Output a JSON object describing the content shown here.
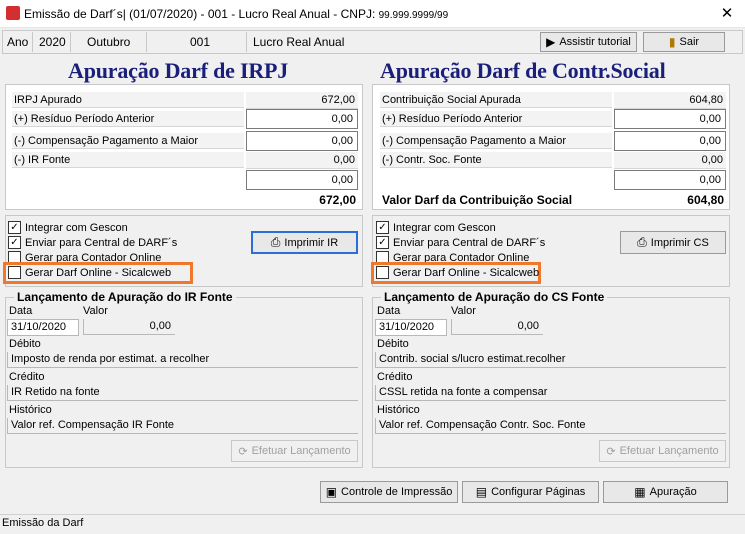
{
  "window": {
    "title": "Emissão de Darf´s| (01/07/2020) - 001 - Lucro Real Anual  - CNPJ:",
    "cnpj": "99.999.9999/99",
    "close": "✕"
  },
  "toolbar": {
    "ano_label": "Ano",
    "ano_value": "2020",
    "mes": "Outubro",
    "empresa": "001",
    "regime": "Lucro Real Anual",
    "tutorial_label": "Assistir tutorial",
    "sair_label": "Sair"
  },
  "irpj": {
    "heading": "Apuração Darf de IRPJ",
    "rows": [
      {
        "label": "IRPJ Apurado",
        "value": "672,00"
      },
      {
        "label": "(+) Resíduo Período Anterior",
        "value": "0,00"
      },
      {
        "label": "(-) Compensação Pagamento a Maior",
        "value": "0,00"
      },
      {
        "label": "(-) IR Fonte",
        "value": "0,00"
      }
    ],
    "extra_value": "0,00",
    "total_label": "",
    "total_value": "672,00",
    "checks": [
      {
        "label": "Integrar com Gescon",
        "checked": true
      },
      {
        "label": "Enviar para Central de DARF´s",
        "checked": true
      },
      {
        "label": "Gerar para Contador Online",
        "checked": false
      },
      {
        "label": "Gerar Darf Online - Sicalcweb",
        "checked": false
      }
    ],
    "print_label": "Imprimir IR",
    "launch": {
      "title": "Lançamento de Apuração do IR Fonte",
      "data_label": "Data",
      "valor_label": "Valor",
      "data": "31/10/2020",
      "valor": "0,00",
      "debito_label": "Débito",
      "debito": "Imposto de renda por estimat. a recolher",
      "credito_label": "Crédito",
      "credito": "IR Retido na fonte",
      "historico_label": "Histórico",
      "historico": "Valor ref. Compensação IR Fonte",
      "button": "Efetuar Lançamento"
    }
  },
  "cs": {
    "heading": "Apuração Darf de Contr.Social",
    "rows": [
      {
        "label": "Contribuição Social Apurada",
        "value": "604,80"
      },
      {
        "label": "(+) Resíduo Período Anterior",
        "value": "0,00"
      },
      {
        "label": "(-) Compensação Pagamento a Maior",
        "value": "0,00"
      },
      {
        "label": "(-) Contr. Soc. Fonte",
        "value": "0,00"
      }
    ],
    "extra_value": "0,00",
    "total_label": "Valor Darf da Contribuição Social",
    "total_value": "604,80",
    "checks": [
      {
        "label": "Integrar com Gescon",
        "checked": true
      },
      {
        "label": "Enviar para Central de DARF´s",
        "checked": true
      },
      {
        "label": "Gerar para Contador Online",
        "checked": false
      },
      {
        "label": "Gerar Darf Online - Sicalcweb",
        "checked": false
      }
    ],
    "print_label": "Imprimir CS",
    "launch": {
      "title": "Lançamento de Apuração do CS Fonte",
      "data_label": "Data",
      "valor_label": "Valor",
      "data": "31/10/2020",
      "valor": "0,00",
      "debito_label": "Débito",
      "debito": "Contrib. social s/lucro estimat.recolher",
      "credito_label": "Crédito",
      "credito": "CSSL retida na fonte a compensar",
      "historico_label": "Histórico",
      "historico": "Valor ref. Compensação Contr. Soc. Fonte",
      "button": "Efetuar Lançamento"
    }
  },
  "footer": {
    "controle_label": "Controle de Impressão",
    "paginas_label": "Configurar Páginas",
    "apuracao_label": "Apuração"
  },
  "status": "Emissão da Darf",
  "colors": {
    "heading": "#1a1f7a",
    "highlight": "#f0782a"
  }
}
